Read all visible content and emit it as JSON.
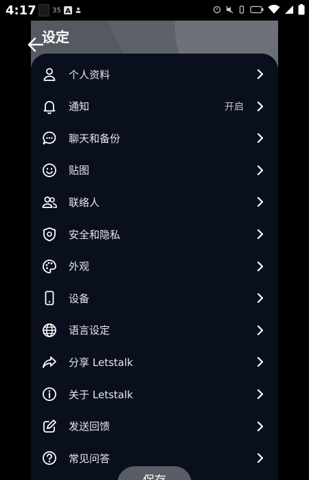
{
  "status_bar": {
    "time": "4:17",
    "left_extra": "35"
  },
  "header": {
    "title": "设定"
  },
  "menu": [
    {
      "key": "profile",
      "label": "个人资料",
      "icon": "person-icon"
    },
    {
      "key": "notifications",
      "label": "通知",
      "value": "开启",
      "icon": "bell-icon"
    },
    {
      "key": "chat-backup",
      "label": "聊天和备份",
      "icon": "chat-bubble-icon"
    },
    {
      "key": "stickers",
      "label": "贴图",
      "icon": "smiley-icon"
    },
    {
      "key": "contacts",
      "label": "联络人",
      "icon": "contacts-icon"
    },
    {
      "key": "security-privacy",
      "label": "安全和隐私",
      "icon": "shield-icon"
    },
    {
      "key": "appearance",
      "label": "外观",
      "icon": "palette-icon"
    },
    {
      "key": "devices",
      "label": "设备",
      "icon": "phone-icon"
    },
    {
      "key": "language",
      "label": "语言设定",
      "icon": "globe-icon"
    },
    {
      "key": "share",
      "label": "分享 Letstalk",
      "icon": "share-arrow-icon"
    },
    {
      "key": "about",
      "label": "关于 Letstalk",
      "icon": "info-icon"
    },
    {
      "key": "feedback",
      "label": "发送回馈",
      "icon": "edit-feedback-icon"
    },
    {
      "key": "faq",
      "label": "常见问答",
      "icon": "question-icon"
    }
  ],
  "footer": {
    "save_label": "保存"
  }
}
